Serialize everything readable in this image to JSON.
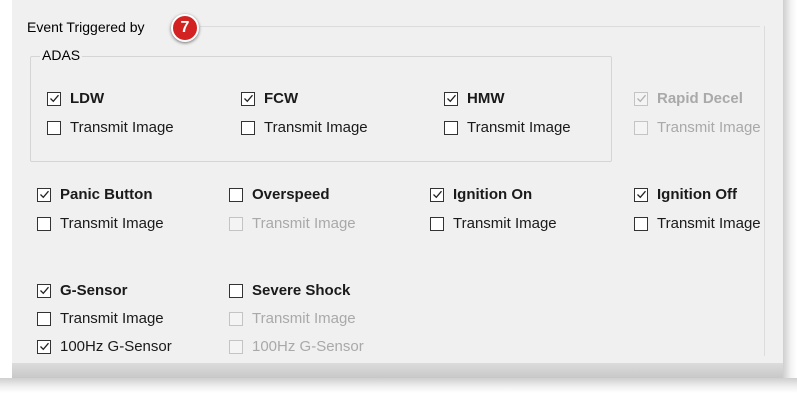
{
  "section": {
    "title": "Event Triggered by",
    "badge": "7"
  },
  "adas": {
    "label": "ADAS",
    "items": [
      {
        "label": "LDW",
        "checked": true,
        "transmit_label": "Transmit Image",
        "transmit_checked": false
      },
      {
        "label": "FCW",
        "checked": true,
        "transmit_label": "Transmit Image",
        "transmit_checked": false
      },
      {
        "label": "HMW",
        "checked": true,
        "transmit_label": "Transmit Image",
        "transmit_checked": false
      }
    ],
    "rapid_decel": {
      "label": "Rapid Decel",
      "checked": true,
      "transmit_label": "Transmit Image",
      "transmit_checked": false
    }
  },
  "events": [
    {
      "label": "Panic Button",
      "checked": true,
      "transmit_label": "Transmit Image",
      "transmit_checked": false
    },
    {
      "label": "Overspeed",
      "checked": false,
      "transmit_label": "Transmit Image",
      "transmit_checked": false
    },
    {
      "label": "Ignition On",
      "checked": true,
      "transmit_label": "Transmit Image",
      "transmit_checked": false
    },
    {
      "label": "Ignition Off",
      "checked": true,
      "transmit_label": "Transmit Image",
      "transmit_checked": false
    }
  ],
  "sensors": [
    {
      "label": "G-Sensor",
      "checked": true,
      "transmit_label": "Transmit Image",
      "transmit_checked": false,
      "hz_label": "100Hz G-Sensor",
      "hz_checked": true
    },
    {
      "label": "Severe Shock",
      "checked": false,
      "transmit_label": "Transmit Image",
      "transmit_checked": false,
      "hz_label": "100Hz G-Sensor",
      "hz_checked": false
    }
  ]
}
